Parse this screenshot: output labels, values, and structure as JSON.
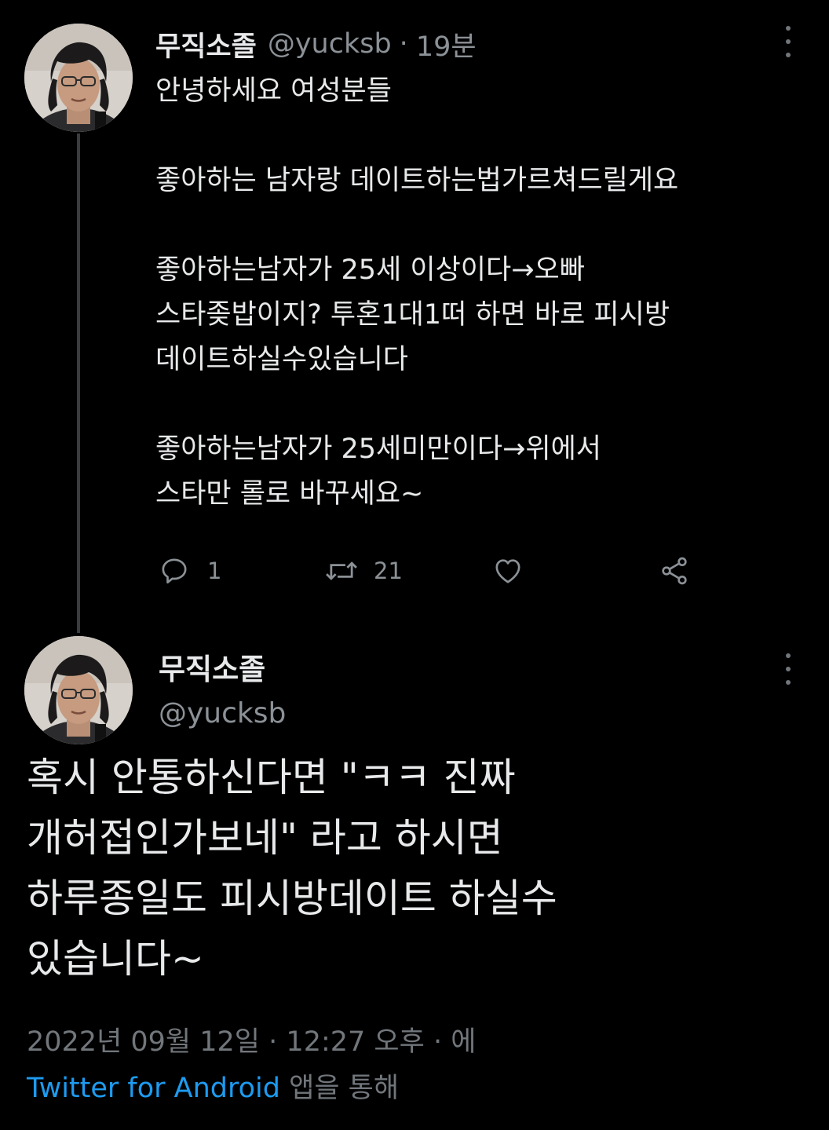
{
  "tweet1": {
    "author_name": "무직소졸",
    "handle": "@yucksb",
    "separator": "·",
    "time": "19분",
    "lines": [
      "안녕하세요 여성분들",
      "",
      "좋아하는 남자랑 데이트하는법가르쳐드릴게요",
      "",
      "좋아하는남자가 25세 이상이다→오빠",
      "스타좆밥이지? 투혼1대1떠 하면 바로 피시방",
      "데이트하실수있습니다",
      "",
      "좋아하는남자가 25세미만이다→위에서",
      "스타만 롤로 바꾸세요~"
    ],
    "actions": {
      "reply_icon": "reply-icon",
      "reply_count": "1",
      "retweet_icon": "retweet-icon",
      "retweet_count": "21",
      "like_icon": "heart-icon",
      "share_icon": "share-icon"
    },
    "more_icon": "more-vertical-icon"
  },
  "tweet2": {
    "author_name": "무직소졸",
    "handle": "@yucksb",
    "more_icon": "more-vertical-icon",
    "lines": [
      "혹시 안통하신다면 \"ㅋㅋ 진짜",
      "개허접인가보네\" 라고 하시면",
      "하루종일도 피시방데이트 하실수",
      "있습니다~"
    ],
    "date": "2022년 09월 12일",
    "sep1": "·",
    "time": "12:27 오후",
    "sep2": "·",
    "via_prefix": "에",
    "source": "Twitter for Android",
    "via_suffix": "앱을 통해"
  },
  "colors": {
    "background": "#000000",
    "text": "#e7e9ea",
    "muted": "#71767b",
    "link": "#1d9bf0"
  }
}
